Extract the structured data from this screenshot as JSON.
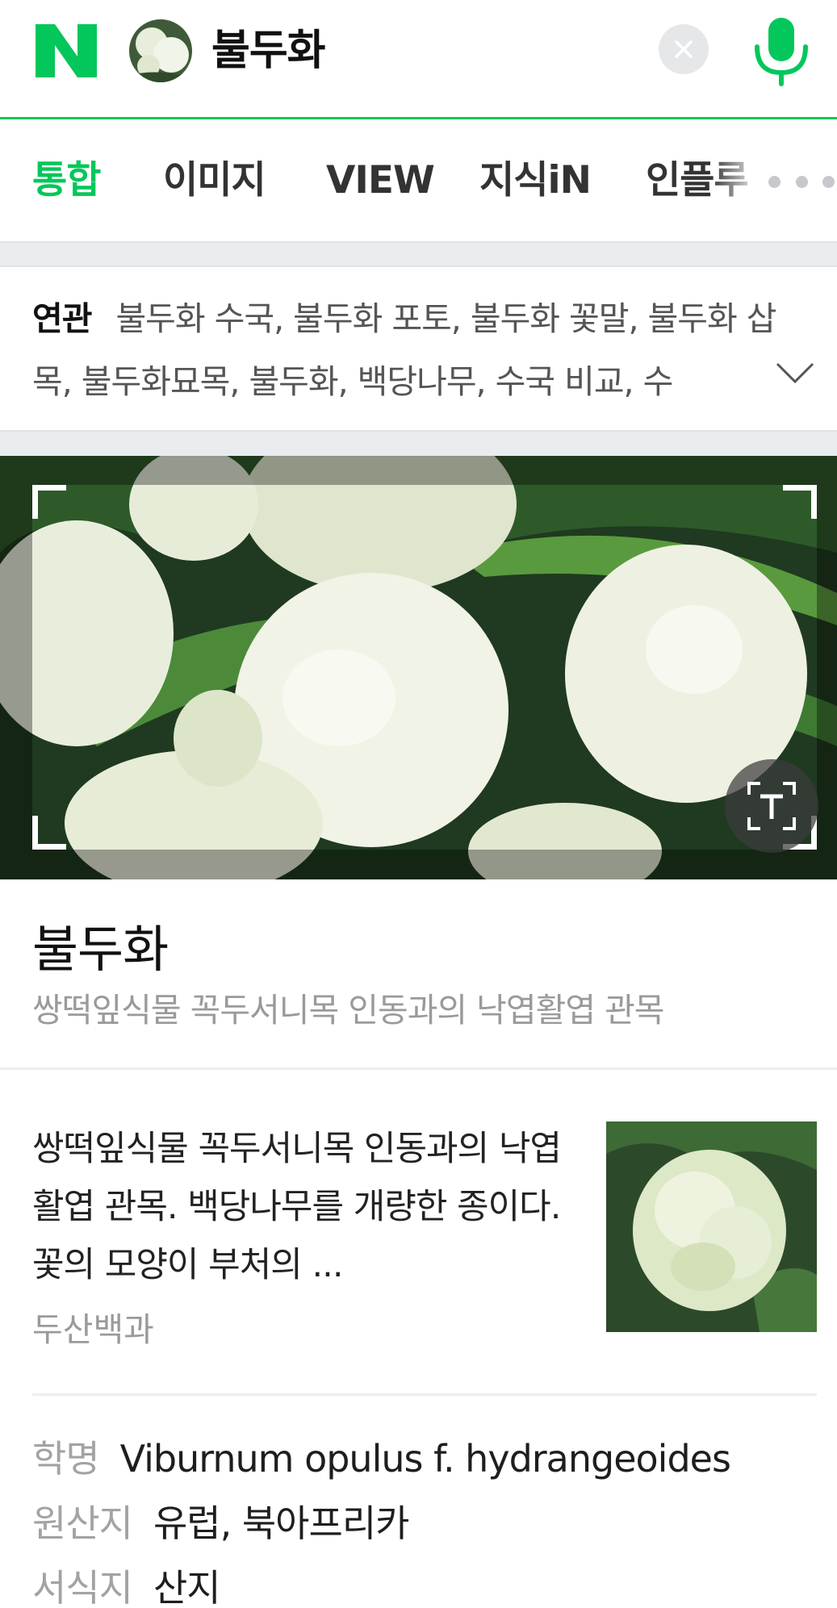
{
  "search": {
    "logo": "N",
    "query": "불두화",
    "icons": {
      "clear": "close-icon",
      "voice": "mic-icon"
    },
    "accent": "#03c75a"
  },
  "tabs": [
    {
      "label": "통합",
      "active": true
    },
    {
      "label": "이미지",
      "active": false
    },
    {
      "label": "VIEW",
      "active": false
    },
    {
      "label": "지식iN",
      "active": false
    },
    {
      "label": "인플루",
      "active": false
    }
  ],
  "related": {
    "label": "연관",
    "text": "불두화 수국, 불두화 포토, 불두화 꽃말, 불두화 삽목, 불두화묘목, 불두화, 백당나무, 수국 비교, 수"
  },
  "entity": {
    "title": "불두화",
    "subtitle": "쌍떡잎식물 꼭두서니목 인동과의 낙엽활엽 관목",
    "description": "쌍떡잎식물 꼭두서니목 인동과의 낙엽활엽 관목. 백당나무를 개량한 종이다. 꽃의 모양이 부처의 ...",
    "source": "두산백과"
  },
  "info": [
    {
      "key": "학명",
      "value": "Viburnum opulus f. hydrangeoides"
    },
    {
      "key": "원산지",
      "value": "유럽, 북아프리카"
    },
    {
      "key": "서식지",
      "value": "산지"
    }
  ]
}
